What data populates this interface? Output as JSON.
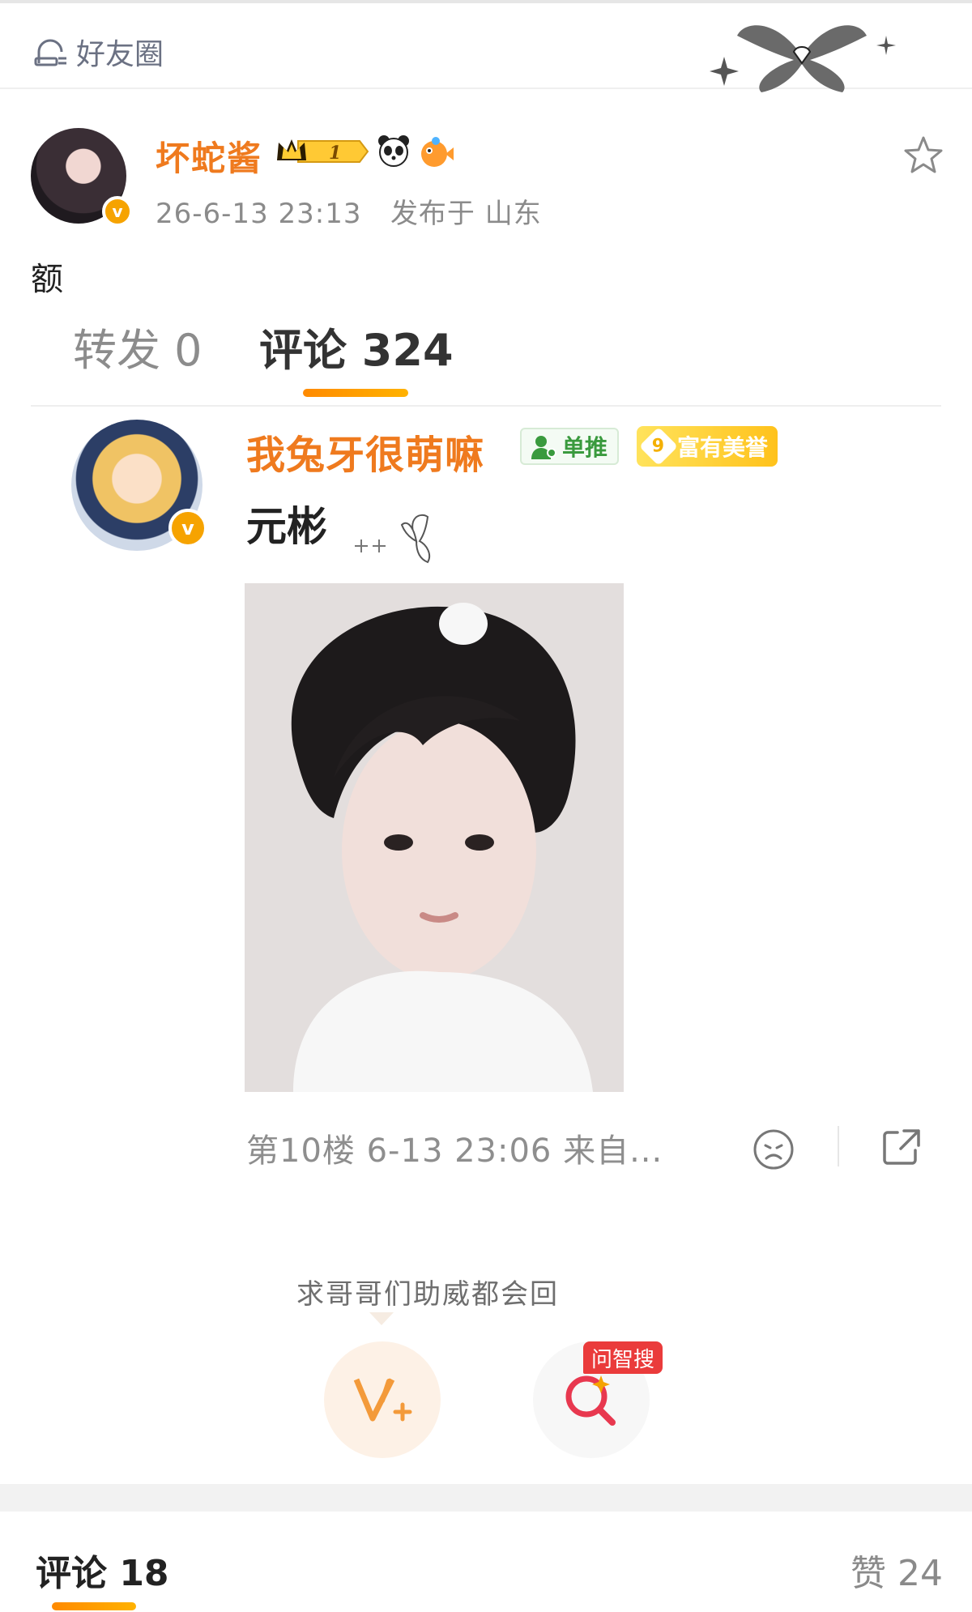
{
  "header": {
    "title": "好友圈",
    "icon": "friend-circle-icon"
  },
  "post": {
    "author": "坏蛇酱",
    "level": "1",
    "timestamp": "26-6-13 23:13",
    "location": "发布于 山东",
    "text": "额"
  },
  "tabs": {
    "repost": "转发 0",
    "comments": "评论 324"
  },
  "comment": {
    "user": "我兔牙很萌嘛",
    "tag_single": "单推",
    "tag_rich_level": "9",
    "tag_rich_label": "富有美誉",
    "text": "元彬",
    "meta": "第10楼 6-13 23:06 来自..."
  },
  "float": {
    "hint": "求哥哥们助威都会回",
    "ask_badge": "问智搜"
  },
  "bottom": {
    "comments": "评论 18",
    "likes": "赞 24"
  },
  "colors": {
    "accent": "#ef7a1e",
    "underline": "#ff9a00",
    "muted": "#8b8b8b"
  }
}
